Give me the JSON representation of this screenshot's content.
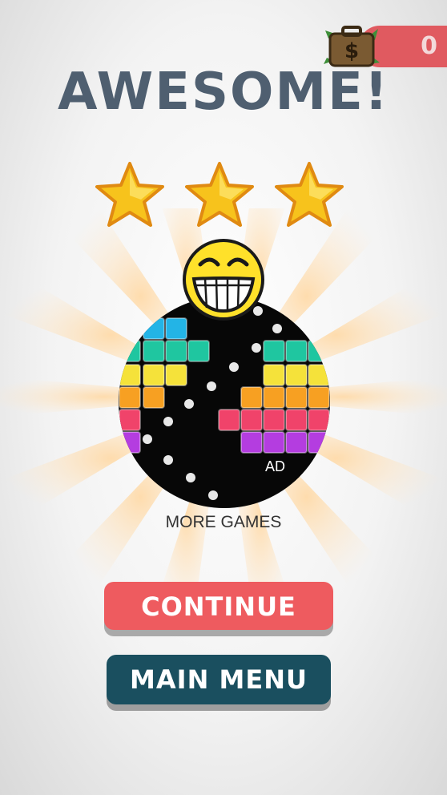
{
  "hud": {
    "coins": "0",
    "coin_icon": "money-briefcase-icon"
  },
  "result": {
    "title": "AWESOME!",
    "stars_earned": 3,
    "stars_total": 3
  },
  "promo": {
    "ad_label": "AD",
    "caption": "MORE GAMES"
  },
  "buttons": {
    "continue_label": "CONTINUE",
    "main_menu_label": "MAIN MENU"
  },
  "colors": {
    "title": "#4f5f70",
    "star": "#f7c31c",
    "continue": "#ee5b5f",
    "main_menu": "#1a4f5f",
    "coin_bar": "#e05a60"
  }
}
